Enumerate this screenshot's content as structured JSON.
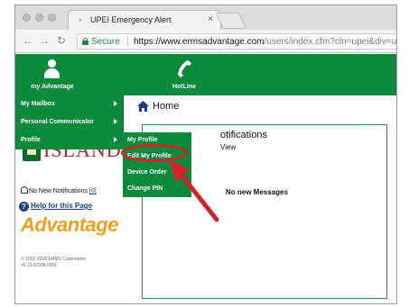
{
  "browser": {
    "tab_title": "UPEI Emergency Alert",
    "tab_close": "×",
    "secure_label": "Secure",
    "url_host": "https://www.ermsadvantage.com",
    "url_path": "/users/index.cfm?cln=upei&div=upei"
  },
  "header": {
    "my_advantage": "my Advantage",
    "hotline": "HotLine",
    "colors": {
      "green": "#0a8a3a"
    }
  },
  "menu": {
    "items": [
      {
        "label": "My Mailbox"
      },
      {
        "label": "Personal Communicator"
      },
      {
        "label": "Profile"
      }
    ],
    "submenu": [
      {
        "label": "My Profile"
      },
      {
        "label": "Edit My Profile"
      },
      {
        "label": "Device Order"
      },
      {
        "label": "Change PIN"
      }
    ]
  },
  "home": {
    "label": "Home"
  },
  "sidebar": {
    "island": "ISLAND",
    "notifications_label": "No New Notifications",
    "notifications_count": "[0]",
    "help": "Help for this Page",
    "advantage": "Advantage",
    "copyright_1": "© 2002-2018 ERMS Corporation",
    "copyright_2": "v6.15.01908.0001"
  },
  "panel": {
    "title": "otifications",
    "view": "View",
    "messages": "No new Messages"
  },
  "annotation": {
    "color": "#d8202a"
  }
}
